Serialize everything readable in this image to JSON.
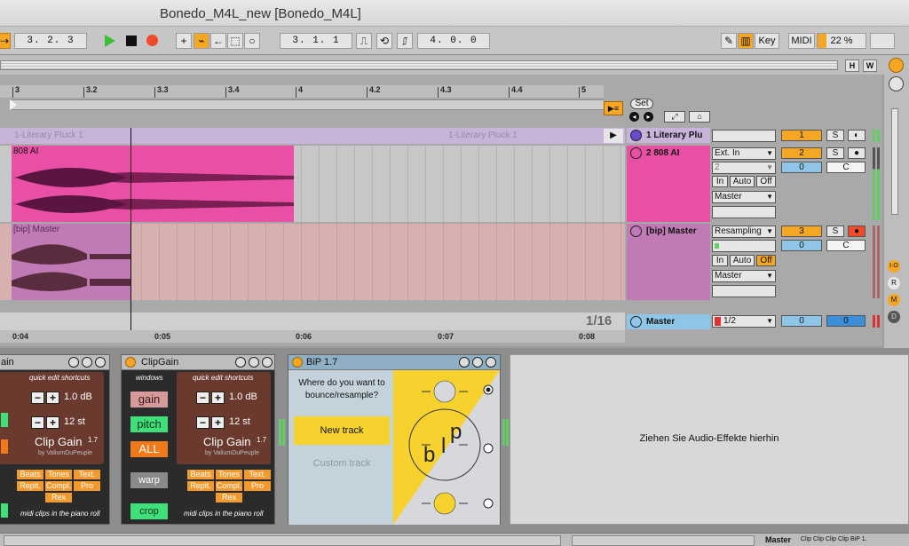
{
  "window": {
    "title": "Bonedo_M4L_new  [Bonedo_M4L]"
  },
  "control_bar": {
    "arrangement_position": "3. 2. 3",
    "loop_start": "3. 1. 1",
    "loop_length": "4. 0. 0",
    "key_label": "Key",
    "midi_label": "MIDI",
    "cpu_load": "22 %"
  },
  "header_buttons": {
    "h": "H",
    "w": "W"
  },
  "ruler": {
    "bar_labels": [
      "3",
      "3.2",
      "3.3",
      "3.4",
      "4",
      "4.2",
      "4.3",
      "4.4",
      "5"
    ],
    "time_labels": [
      "0:04",
      "0:05",
      "0:06",
      "0:07",
      "0:08"
    ],
    "grid_label": "1/16"
  },
  "set_label": "Set",
  "tracks": [
    {
      "name": "1 Literary Plu",
      "clip_name": "1-Literary Pluck 1",
      "clip_name_2": "1-Literary Pluck 1",
      "number": "1",
      "solo": "S",
      "color": "#c8b3d9"
    },
    {
      "name": "2 808 AI",
      "clip_name": "808 AI",
      "input_type": "Ext. In",
      "input_channel": "2",
      "monitor": [
        "In",
        "Auto",
        "Off"
      ],
      "output": "Master",
      "number": "2",
      "solo": "S",
      "volume": "0",
      "pan": "C",
      "color": "#e84fa5"
    },
    {
      "name": "[bip] Master",
      "clip_name": "[bip] Master",
      "input_type": "Resampling",
      "monitor": [
        "In",
        "Auto",
        "Off"
      ],
      "output": "Master",
      "number": "3",
      "solo": "S",
      "volume": "0",
      "pan": "C",
      "color": "#c07ab5"
    }
  ],
  "master": {
    "name": "Master",
    "output": "1/2",
    "volume": "0",
    "volume_2": "0"
  },
  "side_letters": [
    "R",
    "M",
    "D"
  ],
  "devices": {
    "clipgain_left": {
      "title": "ain",
      "quick_edit": "quick edit shortcuts",
      "gain_value": "1.0 dB",
      "pitch_value": "12 st",
      "brand": "Clip Gain",
      "version": "1.7",
      "author": "by ValiumDuPeuple",
      "tags_row1": [
        "Beats",
        "Tones",
        "Text."
      ],
      "tags_row2": [
        "Repit.",
        "Compl.",
        "Pro"
      ],
      "tags_row3": [
        "Rex"
      ],
      "footer": "midi clips in the piano roll"
    },
    "clipgain": {
      "title": "ClipGain",
      "windows": "windows",
      "gain_btn": "gain",
      "pitch_btn": "pitch",
      "all_btn": "ALL",
      "warp_btn": "warp",
      "crop_btn": "crop",
      "quick_edit": "quick edit shortcuts",
      "gain_value": "1.0 dB",
      "pitch_value": "12 st",
      "brand": "Clip Gain",
      "version": "1.7",
      "author": "by ValiumDuPeuple",
      "tags_row1": [
        "Beats",
        "Tones",
        "Text."
      ],
      "tags_row2": [
        "Repit.",
        "Compl.",
        "Pro"
      ],
      "tags_row3": [
        "Rex"
      ],
      "footer": "midi clips in the piano roll"
    },
    "bip": {
      "title": "BiP 1.7",
      "question": "Where do you want to bounce/resample?",
      "new_track": "New track",
      "custom_track": "Custom track",
      "logo_b": "b",
      "logo_l": "l",
      "logo_p": "p"
    },
    "dropzone": "Ziehen Sie Audio-Effekte hierhin"
  },
  "status": {
    "master_tab": "Master",
    "clips_label": "Clip Clip Clip Clip BiP 1."
  },
  "colors": {
    "accent": "#f5a623",
    "track1": "#c8b3d9",
    "track2": "#e84fa5",
    "track3": "#c07ab5",
    "master": "#8fc6e8"
  }
}
